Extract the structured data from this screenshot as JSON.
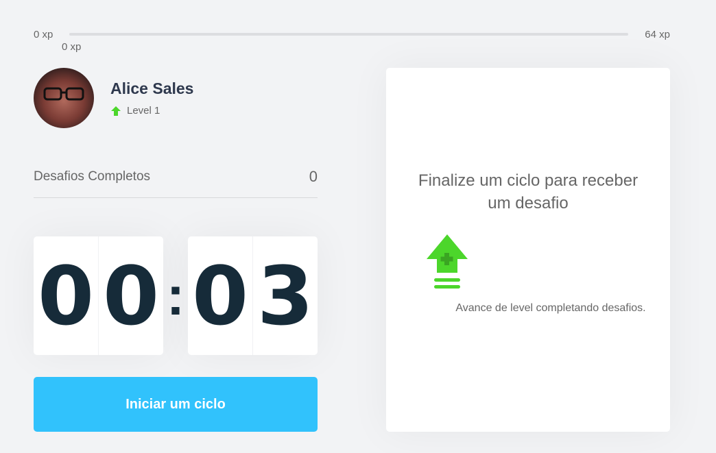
{
  "xp": {
    "min_label": "0 xp",
    "max_label": "64 xp",
    "current_label": "0 xp",
    "progress_fraction": 0
  },
  "profile": {
    "name": "Alice Sales",
    "level": "Level 1"
  },
  "stats": {
    "completed_label": "Desafios Completos",
    "completed_count": "0"
  },
  "countdown": {
    "minute_left": "0",
    "minute_right": "0",
    "separator": ":",
    "second_left": "0",
    "second_right": "3"
  },
  "actions": {
    "start_label": "Iniciar um ciclo"
  },
  "challenge": {
    "title": "Finalize um ciclo para receber um desafio",
    "description": "Avance de level completando desafios.",
    "icon": "level-up-icon"
  },
  "colors": {
    "accent_blue": "#31c2fc",
    "green": "#4cd62b",
    "dark_text": "#162b39"
  }
}
